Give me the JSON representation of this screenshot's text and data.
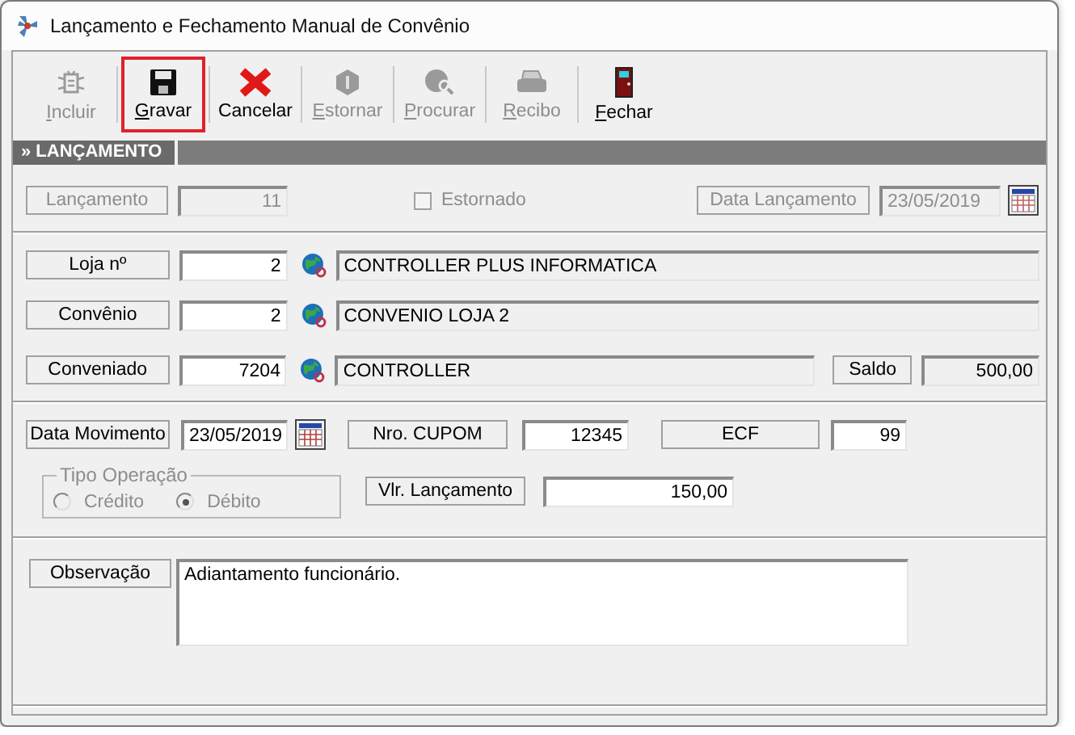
{
  "window": {
    "title": "Lançamento e Fechamento Manual de Convênio"
  },
  "toolbar": [
    {
      "label": "Incluir",
      "disabled": true,
      "mnemonic": true,
      "highlighted": false
    },
    {
      "label": "Gravar",
      "disabled": false,
      "mnemonic": true,
      "highlighted": true
    },
    {
      "label": "Cancelar",
      "disabled": false,
      "mnemonic": false,
      "highlighted": false
    },
    {
      "label": "Estornar",
      "disabled": true,
      "mnemonic": true,
      "highlighted": false
    },
    {
      "label": "Procurar",
      "disabled": true,
      "mnemonic": true,
      "highlighted": false
    },
    {
      "label": "Recibo",
      "disabled": true,
      "mnemonic": true,
      "highlighted": false
    },
    {
      "label": "Fechar",
      "disabled": false,
      "mnemonic": true,
      "highlighted": false
    }
  ],
  "section": {
    "title": "» LANÇAMENTO"
  },
  "header_row": {
    "lancamento": {
      "label": "Lançamento",
      "value": "11",
      "disabled": true
    },
    "estornado": {
      "label": "Estornado",
      "checked": false,
      "disabled": true
    },
    "data_lancamento": {
      "label": "Data Lançamento",
      "value": "23/05/2019",
      "disabled": true
    }
  },
  "lookups": [
    {
      "label": "Loja nº",
      "code": "2",
      "name": "CONTROLLER PLUS INFORMATICA"
    },
    {
      "label": "Convênio",
      "code": "2",
      "name": "CONVENIO LOJA 2"
    },
    {
      "label": "Conveniado",
      "code": "7204",
      "name": "CONTROLLER"
    }
  ],
  "saldo": {
    "label": "Saldo",
    "value": "500,00"
  },
  "data_movimento": {
    "label": "Data Movimento",
    "value": "23/05/2019"
  },
  "nro_cupom": {
    "label": "Nro. CUPOM",
    "value": "12345"
  },
  "ecf": {
    "label": "ECF",
    "value": "99"
  },
  "tipo_operacao": {
    "legend": "Tipo Operação",
    "disabled": true,
    "options": [
      {
        "label": "Crédito",
        "selected": false
      },
      {
        "label": "Débito",
        "selected": true
      }
    ]
  },
  "vlr_lancamento": {
    "label": "Vlr. Lançamento",
    "value": "150,00"
  },
  "observacao": {
    "label": "Observação",
    "value": "Adiantamento funcionário."
  }
}
